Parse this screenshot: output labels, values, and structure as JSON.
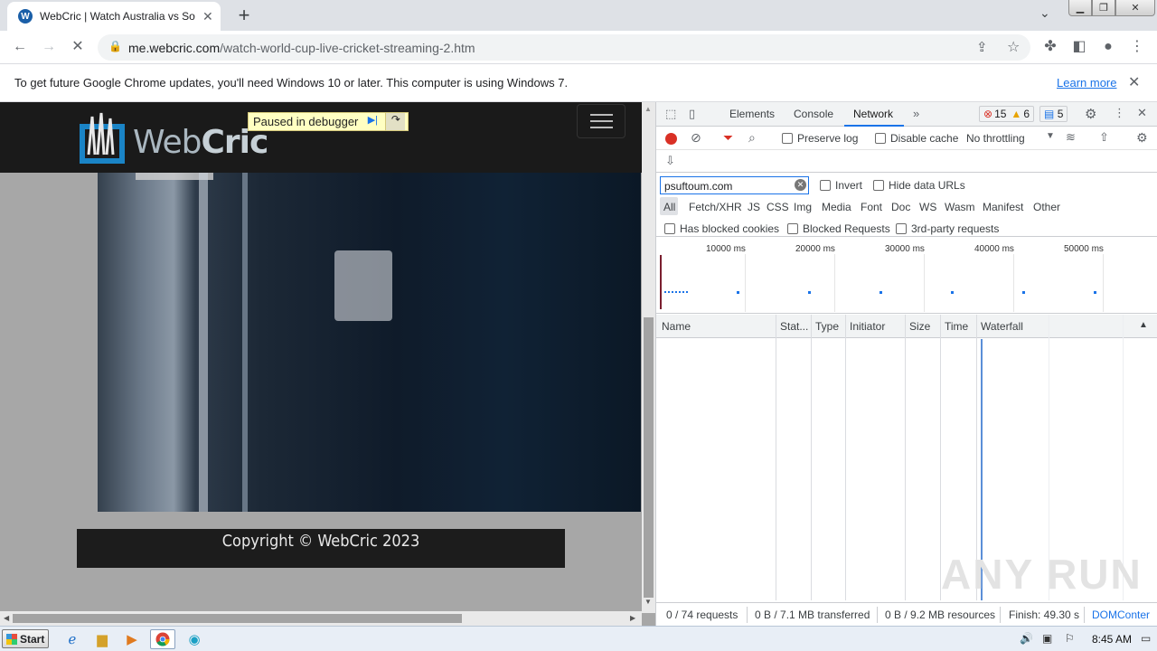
{
  "browser": {
    "tab_title": "WebCric | Watch Australia vs South",
    "tab_favicon": "W",
    "new_tab": "+",
    "url_host": "me.webcric.com",
    "url_path": "/watch-world-cup-live-cricket-streaming-2.htm",
    "infobar_text": "To get future Google Chrome updates, you'll need Windows 10 or later. This computer is using Windows 7.",
    "infobar_link": "Learn more"
  },
  "page": {
    "logo_web": "Web",
    "logo_cric": "Cric",
    "debugger_text": "Paused in debugger",
    "footer_text": "Copyright © WebCric 2023"
  },
  "devtools": {
    "tabs": [
      "Elements",
      "Console",
      "Network"
    ],
    "active_tab": "Network",
    "errors": "15",
    "warnings": "6",
    "messages": "5",
    "preserve_log": "Preserve log",
    "disable_cache": "Disable cache",
    "throttling": "No throttling",
    "filter_value": "psuftoum.com",
    "invert": "Invert",
    "hide_data_urls": "Hide data URLs",
    "types": [
      "All",
      "Fetch/XHR",
      "JS",
      "CSS",
      "Img",
      "Media",
      "Font",
      "Doc",
      "WS",
      "Wasm",
      "Manifest",
      "Other"
    ],
    "has_blocked_cookies": "Has blocked cookies",
    "blocked_requests": "Blocked Requests",
    "third_party": "3rd-party requests",
    "overview_ticks": [
      "10000 ms",
      "20000 ms",
      "30000 ms",
      "40000 ms",
      "50000 ms"
    ],
    "columns": [
      "Name",
      "Stat...",
      "Type",
      "Initiator",
      "Size",
      "Time",
      "Waterfall"
    ],
    "status": {
      "requests": "0 / 74 requests",
      "transferred": "0 B / 7.1 MB transferred",
      "resources": "0 B / 9.2 MB resources",
      "finish": "Finish: 49.30 s",
      "domcontent": "DOMConter"
    }
  },
  "watermark": "ANY RUN",
  "taskbar": {
    "start": "Start",
    "clock": "8:45 AM"
  }
}
